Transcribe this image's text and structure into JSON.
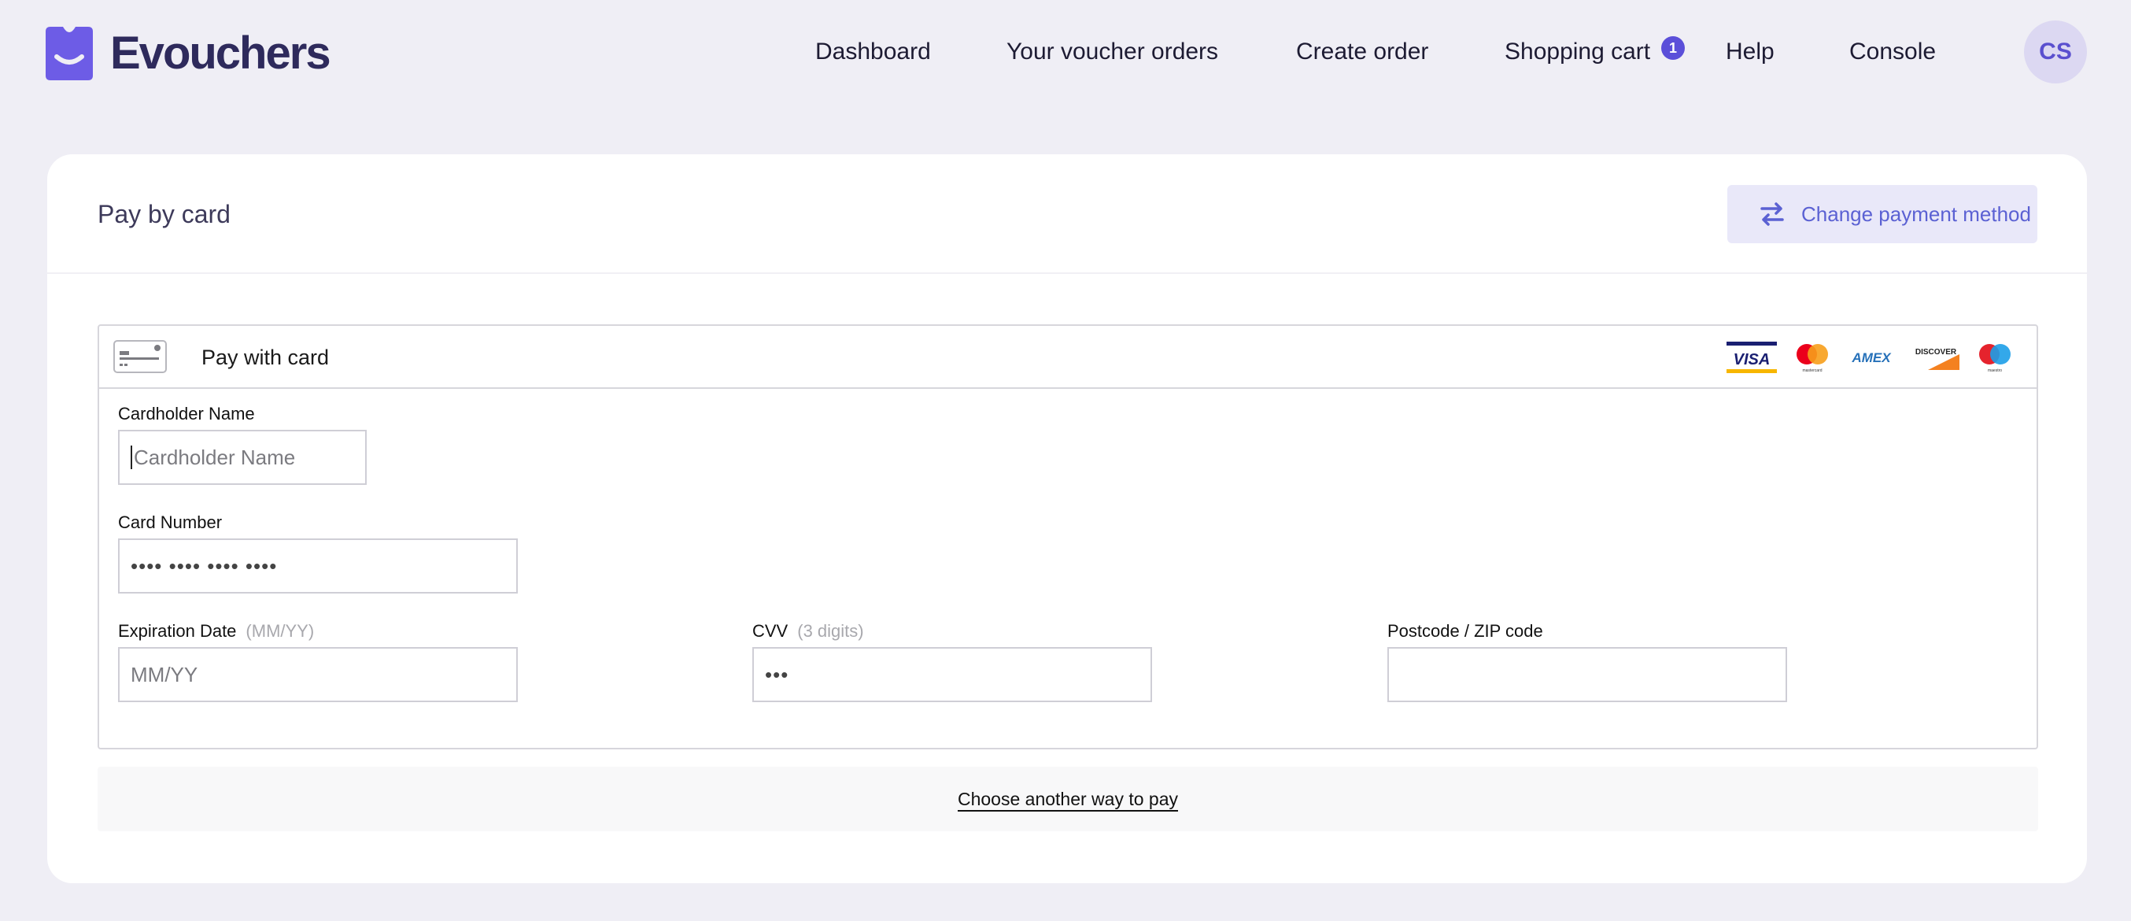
{
  "app": {
    "name": "Evouchers",
    "logo_icon": "evouchers-logo-icon",
    "brand_color": "#5b4fd9"
  },
  "nav": {
    "items": [
      {
        "label": "Dashboard"
      },
      {
        "label": "Your voucher orders"
      },
      {
        "label": "Create order"
      },
      {
        "label": "Shopping cart",
        "badge": "1"
      },
      {
        "label": "Help"
      },
      {
        "label": "Console"
      }
    ],
    "avatar_initials": "CS"
  },
  "payment": {
    "title": "Pay by card",
    "change_button": {
      "label": "Change payment method",
      "icon": "swap-arrows-icon"
    },
    "box": {
      "title": "Pay with card",
      "card_icon": "credit-card-icon",
      "brands": [
        "VISA",
        "mastercard",
        "AMEX",
        "DISCOVER",
        "maestro"
      ]
    },
    "fields": {
      "cardholder": {
        "label": "Cardholder Name",
        "placeholder": "Cardholder Name",
        "value": ""
      },
      "card_number": {
        "label": "Card Number",
        "placeholder": "•••• •••• •••• ••••",
        "value": ""
      },
      "expiration": {
        "label": "Expiration Date",
        "hint": "(MM/YY)",
        "placeholder": "MM/YY",
        "value": ""
      },
      "cvv": {
        "label": "CVV",
        "hint": "(3 digits)",
        "placeholder": "•••",
        "value": ""
      },
      "postcode": {
        "label": "Postcode / ZIP code",
        "placeholder": "",
        "value": ""
      }
    },
    "alt_link": "Choose another way to pay"
  },
  "colors": {
    "page_bg": "#efeef5",
    "card_bg": "#ffffff",
    "accent": "#5b61d3",
    "button_bg": "#e9e8f9"
  }
}
